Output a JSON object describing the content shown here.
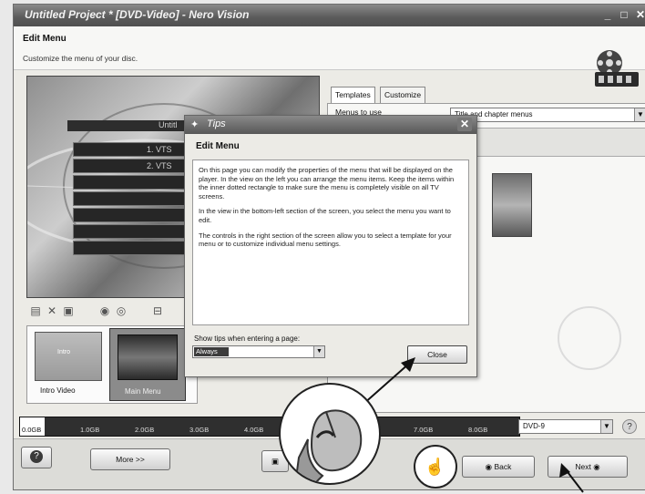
{
  "window": {
    "title": "Untitled Project * [DVD-Video] - Nero Vision"
  },
  "header": {
    "title": "Edit Menu",
    "subtitle": "Customize the menu of your disc."
  },
  "preview": {
    "top_text": "Untitl",
    "rows": [
      "1. VTS",
      "2. VTS"
    ]
  },
  "thumbnails": [
    {
      "label": "Intro Video",
      "image_text": "Intro",
      "selected": false
    },
    {
      "label": "Main Menu",
      "selected": true
    }
  ],
  "right_panel": {
    "tabs": [
      {
        "label": "Templates",
        "active": true
      },
      {
        "label": "Customize",
        "active": false
      }
    ],
    "menus_label": "Menus to use",
    "menus_value": "Title and chapter menus"
  },
  "timeline": {
    "ticks": [
      "0.0GB",
      "1.0GB",
      "2.0GB",
      "3.0GB",
      "4.0GB",
      "7.0GB",
      "8.0GB"
    ],
    "used_fraction": 0.05,
    "disc_type": "DVD-9"
  },
  "buttons": {
    "more": "More >>",
    "back": "Back",
    "next": "Next"
  },
  "tips_dialog": {
    "title": "Tips",
    "heading": "Edit Menu",
    "paragraphs": [
      "On this page you can modify the properties of the menu that will be displayed on the player. In the view on the left you can arrange the menu items. Keep the items within the inner dotted rectangle to make sure the menu is completely visible on all TV screens.",
      "In the view in the bottom-left section of the screen, you select the menu you want to edit.",
      "The controls in the right section of the screen allow you to select a template for your menu or to customize individual menu settings."
    ],
    "show_tips_label": "Show tips when entering a page:",
    "show_tips_value": "Always",
    "close_label": "Close"
  },
  "icons": {
    "film_logo": "film-reel-icon",
    "help": "help-icon",
    "save": "save-icon",
    "mouse": "mouse-click-icon",
    "touch": "touch-gesture-icon"
  }
}
